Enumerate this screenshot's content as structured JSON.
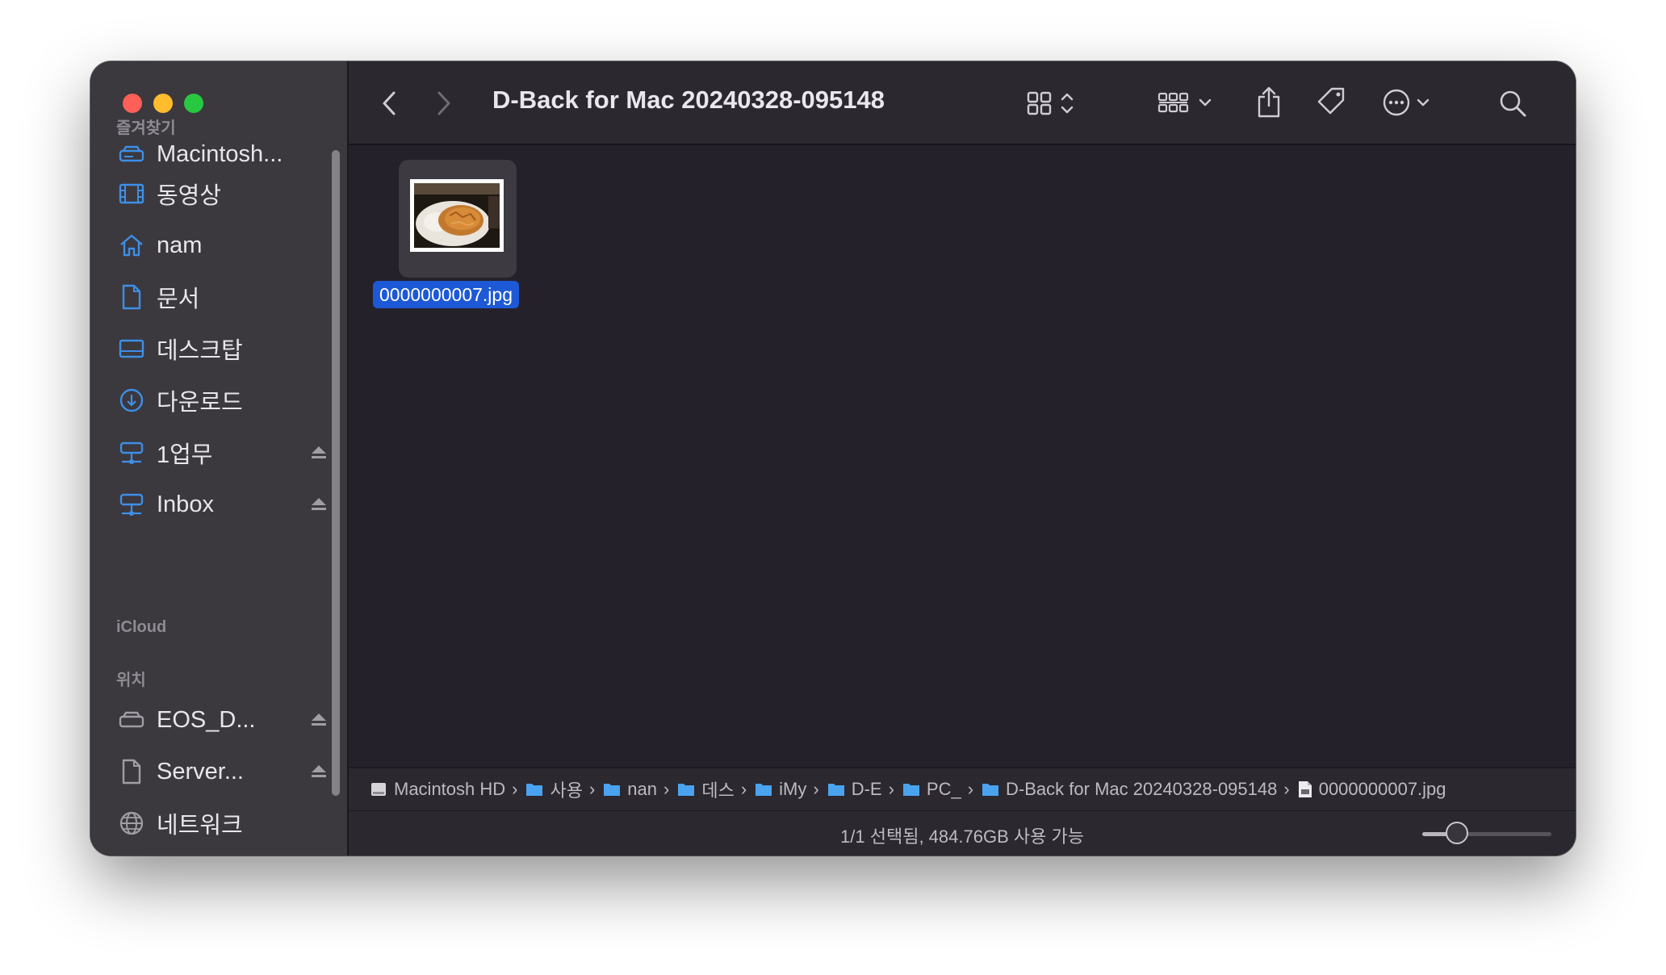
{
  "window": {
    "title": "D-Back for Mac 20240328-095148"
  },
  "sidebar": {
    "sections": {
      "favorites": "즐겨찾기",
      "icloud": "iCloud",
      "locations": "위치"
    },
    "favorites": [
      {
        "label": "Macintosh...",
        "icon": "hard-drive-icon"
      },
      {
        "label": "동영상",
        "icon": "film-icon"
      },
      {
        "label": "nam",
        "icon": "home-icon"
      },
      {
        "label": "문서",
        "icon": "document-icon"
      },
      {
        "label": "데스크탑",
        "icon": "desktop-icon"
      },
      {
        "label": "다운로드",
        "icon": "download-icon"
      },
      {
        "label": "1업무",
        "icon": "network-drive-icon"
      },
      {
        "label": "Inbox",
        "icon": "network-drive-icon"
      }
    ],
    "locations": [
      {
        "label": "EOS_D...",
        "icon": "external-drive-icon"
      },
      {
        "label": "Server...",
        "icon": "server-document-icon"
      },
      {
        "label": "네트워크",
        "icon": "globe-icon"
      }
    ]
  },
  "content": {
    "files": [
      {
        "name": "0000000007.jpg",
        "selected": true
      }
    ]
  },
  "pathbar": {
    "crumbs": [
      "Macintosh HD",
      "사용",
      "nan",
      "데스",
      "iMy",
      "D-E",
      "PC_",
      "D-Back for Mac 20240328-095148",
      "0000000007.jpg"
    ]
  },
  "status": {
    "text": "1/1 선택됨, 484.76GB 사용 가능",
    "icon_size_slider": 0.27
  },
  "colors": {
    "accent": "#3d8fe8",
    "selection": "#1d59d6",
    "folder": "#4aa3ef"
  }
}
